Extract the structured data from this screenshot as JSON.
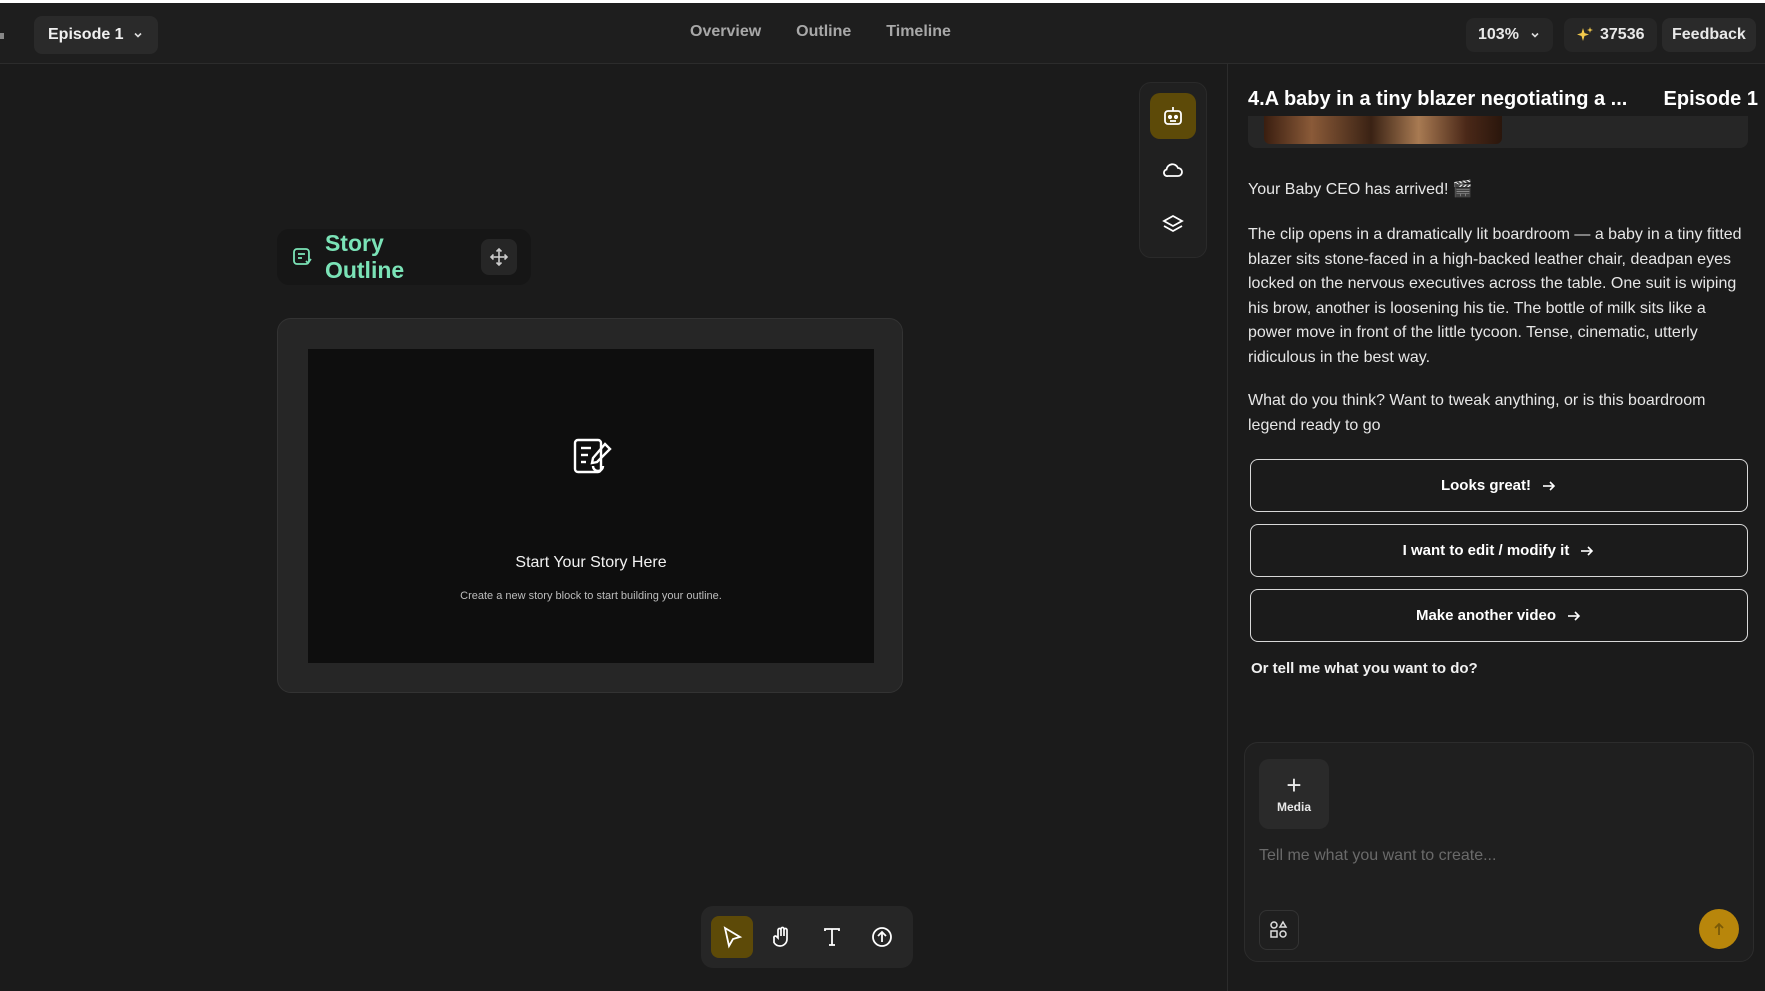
{
  "topbar": {
    "episode_label": "Episode 1",
    "nav": [
      "Overview",
      "Outline",
      "Timeline"
    ],
    "zoom": "103%",
    "credits": "37536",
    "feedback": "Feedback"
  },
  "canvas": {
    "outline_title": "Story Outline",
    "card_title": "Start Your Story Here",
    "card_subtitle": "Create a new story block to start building your outline."
  },
  "panel": {
    "title": "4.A baby in a tiny blazer negotiating a ...",
    "episode": "Episode 1",
    "msg1": "Your Baby CEO has arrived! 🎬",
    "msg2": "The clip opens in a dramatically lit boardroom — a baby in a tiny fitted blazer sits stone-faced in a high-backed leather chair, deadpan eyes locked on the nervous executives across the table. One suit is wiping his brow, another is loosening his tie. The bottle of milk sits like a power move in front of the little tycoon. Tense, cinematic, utterly ridiculous in the best way.",
    "msg3": "What do you think? Want to tweak anything, or is this boardroom legend ready to go",
    "choices": [
      "Looks great!",
      "I want to edit / modify it",
      "Make another video"
    ],
    "or_text": "Or tell me what you want to do?",
    "media_label": "Media",
    "input_placeholder": "Tell me what you want to create..."
  },
  "colors": {
    "accent": "#b8860b",
    "active_bg": "#5d4a08",
    "outline_green": "#7be3b7"
  }
}
